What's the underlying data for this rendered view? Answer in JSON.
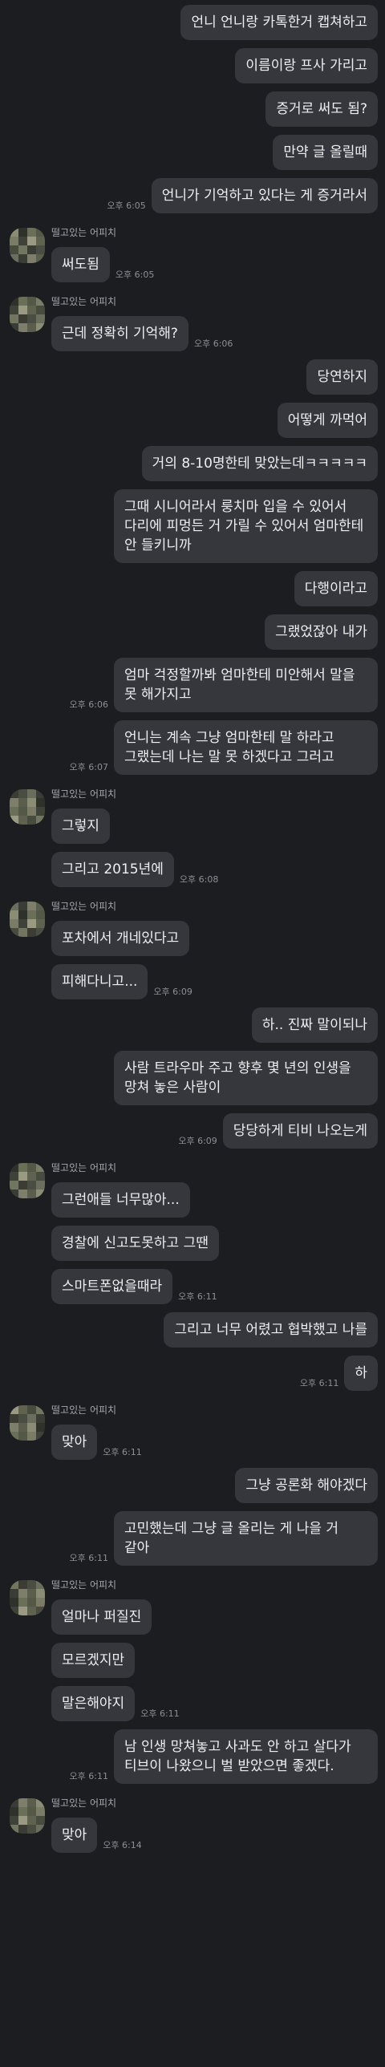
{
  "sender_name": "떨고있는 어피치",
  "colors": {
    "background": "#1c1d21",
    "bubble": "#36373d",
    "text": "#eeeef0",
    "time": "#8e8f94"
  },
  "messages": [
    {
      "id": "m1",
      "from": "me",
      "text": "언니 언니랑 카톡한거 캡쳐하고"
    },
    {
      "id": "m2",
      "from": "me",
      "text": "이름이랑 프사 가리고"
    },
    {
      "id": "m3",
      "from": "me",
      "text": "증거로 써도 됨?"
    },
    {
      "id": "m4",
      "from": "me",
      "text": "만약 글 올릴때"
    },
    {
      "id": "m5",
      "from": "me",
      "text": "언니가 기억하고 있다는 게 증거라서",
      "time": "오후 6:05"
    },
    {
      "id": "m6",
      "from": "them",
      "start": true,
      "text": "써도됨",
      "time": "오후 6:05"
    },
    {
      "id": "m7",
      "from": "them",
      "start": true,
      "text": "근데 정확히 기억해?",
      "time": "오후 6:06"
    },
    {
      "id": "m8",
      "from": "me",
      "text": "당연하지"
    },
    {
      "id": "m9",
      "from": "me",
      "text": "어떻게 까먹어"
    },
    {
      "id": "m10",
      "from": "me",
      "text": "거의 8-10명한테 맞았는데ㅋㅋㅋㅋㅋ"
    },
    {
      "id": "m11",
      "from": "me",
      "text": "그때 시니어라서 룽치마 입을 수 있어서 다리에 피멍든 거 가릴 수 있어서 엄마한테 안 들키니까"
    },
    {
      "id": "m12",
      "from": "me",
      "text": "다행이라고"
    },
    {
      "id": "m13",
      "from": "me",
      "text": "그랬었잖아 내가"
    },
    {
      "id": "m14",
      "from": "me",
      "text": "엄마 걱정할까봐 엄마한테 미안해서 말을 못 해가지고",
      "time": "오후 6:06"
    },
    {
      "id": "m15",
      "from": "me",
      "text": "언니는 계속 그냥 엄마한테 말 하라고 그랬는데 나는 말 못 하겠다고 그러고",
      "time": "오후 6:07"
    },
    {
      "id": "m16",
      "from": "them",
      "start": true,
      "text": "그렇지"
    },
    {
      "id": "m17",
      "from": "them",
      "text": "그리고 2015년에",
      "time": "오후 6:08"
    },
    {
      "id": "m18",
      "from": "them",
      "start": true,
      "text": "포차에서 개네있다고"
    },
    {
      "id": "m19",
      "from": "them",
      "text": "피해다니고...",
      "time": "오후 6:09"
    },
    {
      "id": "m20",
      "from": "me",
      "text": "하.. 진짜 말이되나"
    },
    {
      "id": "m21",
      "from": "me",
      "text": "사람 트라우마 주고 향후 몇 년의 인생을 망쳐 놓은 사람이"
    },
    {
      "id": "m22",
      "from": "me",
      "text": "당당하게 티비 나오는게",
      "time": "오후 6:09"
    },
    {
      "id": "m23",
      "from": "them",
      "start": true,
      "text": "그런애들 너무많아..."
    },
    {
      "id": "m24",
      "from": "them",
      "text": "경찰에 신고도못하고 그땐"
    },
    {
      "id": "m25",
      "from": "them",
      "text": "스마트폰없을때라",
      "time": "오후 6:11"
    },
    {
      "id": "m26",
      "from": "me",
      "text": "그리고 너무 어렸고 협박했고 나를"
    },
    {
      "id": "m27",
      "from": "me",
      "text": "하",
      "time": "오후 6:11"
    },
    {
      "id": "m28",
      "from": "them",
      "start": true,
      "text": "맞아",
      "time": "오후 6:11"
    },
    {
      "id": "m29",
      "from": "me",
      "text": "그냥 공론화 해야겠다"
    },
    {
      "id": "m30",
      "from": "me",
      "text": "고민했는데 그냥 글 올리는 게 나을 거 같아",
      "time": "오후 6:11"
    },
    {
      "id": "m31",
      "from": "them",
      "start": true,
      "text": "얼마나 퍼질진"
    },
    {
      "id": "m32",
      "from": "them",
      "text": "모르겠지만"
    },
    {
      "id": "m33",
      "from": "them",
      "text": "말은해야지",
      "time": "오후 6:11"
    },
    {
      "id": "m34",
      "from": "me",
      "text": "남 인생 망쳐놓고 사과도 안 하고 살다가 티브이 나왔으니 벌 받았으면 좋겠다.",
      "time": "오후 6:11"
    },
    {
      "id": "m35",
      "from": "them",
      "start": true,
      "text": "맞아",
      "time": "오후 6:14"
    }
  ]
}
